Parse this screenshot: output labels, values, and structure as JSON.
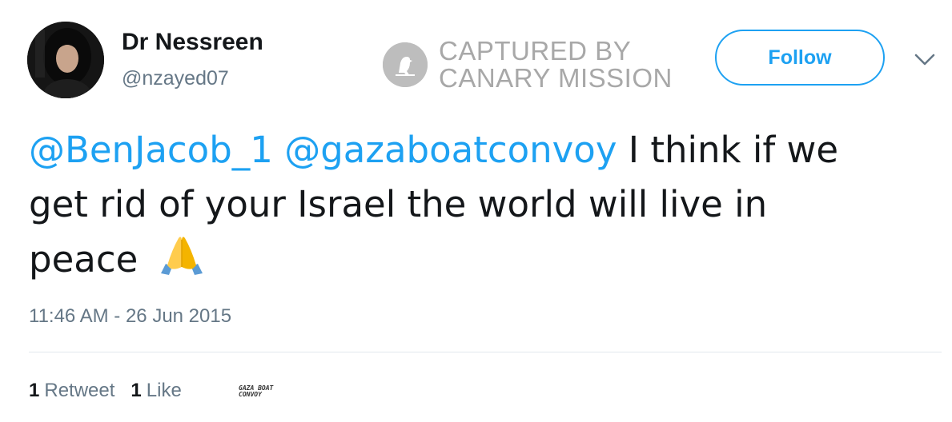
{
  "user": {
    "display_name": "Dr Nessreen",
    "handle": "@nzayed07"
  },
  "stamp": {
    "line1": "CAPTURED BY",
    "line2": "CANARY MISSION"
  },
  "follow_button": {
    "label": "Follow"
  },
  "tweet": {
    "mention1": "@BenJacob_1",
    "mention2": "@gazaboatconvoy",
    "text_line1_end": " I think if we",
    "text_line2": "get rid of your Israel the world will live in",
    "text_line3": "peace",
    "emoji": "folded-hands-emoji",
    "timestamp": "11:46 AM - 26 Jun 2015"
  },
  "stats": {
    "retweets_count": "1",
    "retweets_label": "Retweet",
    "likes_count": "1",
    "likes_label": "Like"
  },
  "liker_avatar_text": {
    "line1": "GAZA BOAT",
    "line2": "CONVOY"
  },
  "colors": {
    "accent": "#1da1f2",
    "text": "#14171a",
    "secondary": "#657786",
    "divider": "#e1e8ed",
    "stamp": "#a8a8a8"
  }
}
